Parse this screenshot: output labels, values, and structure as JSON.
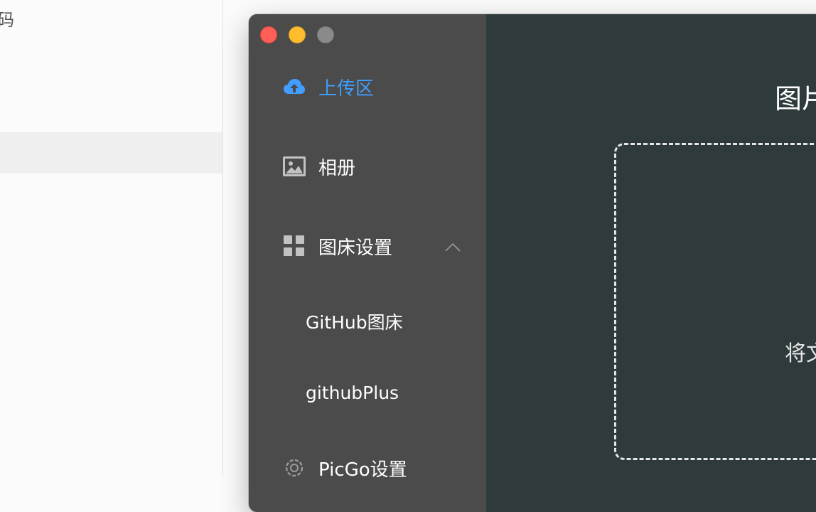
{
  "background_app": {
    "partial_glyph": "码"
  },
  "window": {
    "sidebar": {
      "items": [
        {
          "label": "上传区",
          "icon": "cloud-upload-icon",
          "active": true
        },
        {
          "label": "相册",
          "icon": "image-icon",
          "active": false
        },
        {
          "label": "图床设置",
          "icon": "grid-icon",
          "active": false,
          "expanded": true,
          "children": [
            {
              "label": "GitHub图床"
            },
            {
              "label": "githubPlus"
            }
          ]
        },
        {
          "label": "PicGo设置",
          "icon": "gear-icon",
          "active": false
        }
      ]
    },
    "main": {
      "title": "图片",
      "dropzone_text": "将文"
    }
  },
  "colors": {
    "accent": "#409eff",
    "sidebar_bg": "#4b4b4b",
    "main_bg": "#2e3a3c",
    "close": "#fe5f57",
    "minimize": "#febc2e",
    "zoom_inactive": "#8a8a8a"
  }
}
